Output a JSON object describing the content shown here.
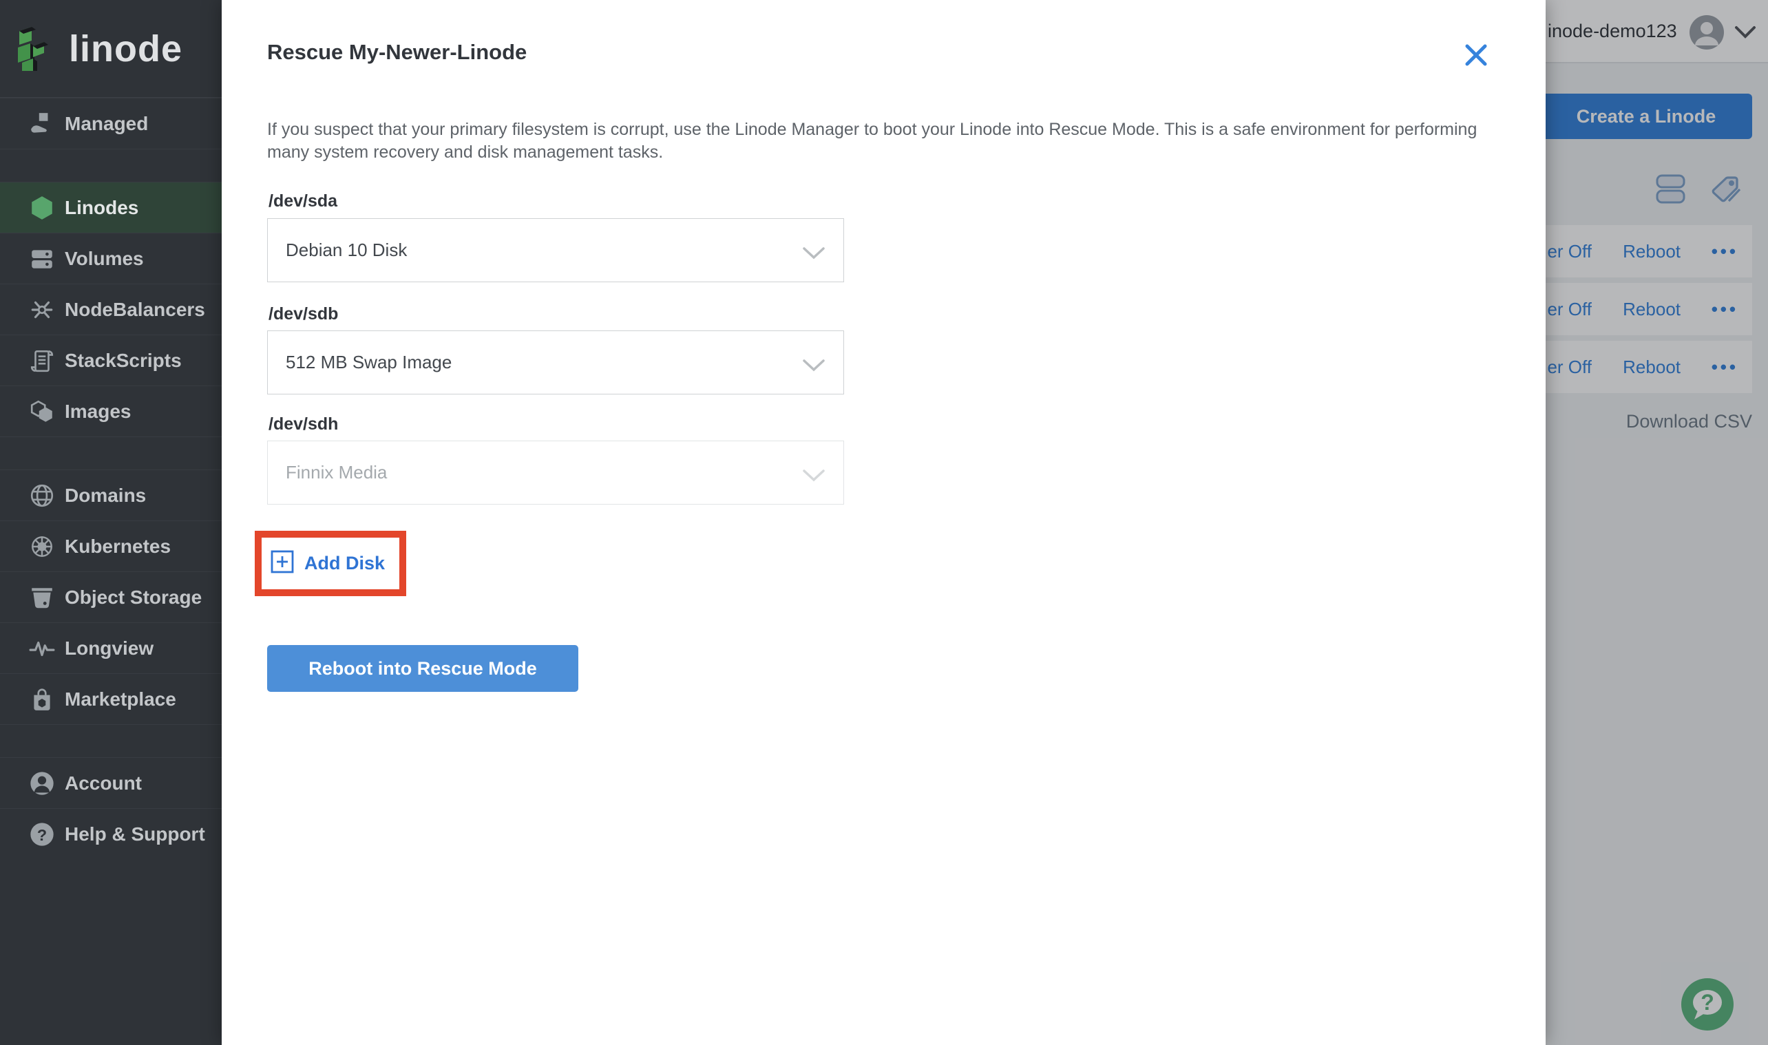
{
  "colors": {
    "accent_blue": "#3683dc",
    "link_blue": "#3683dc",
    "add_disk_blue": "#2f74d4",
    "highlight_red": "#e3462b",
    "sidebar_bg": "#2f3338",
    "sidebar_active_bg": "#2f4438",
    "active_green": "#58a56c",
    "help_green": "#5cb57e",
    "reboot_button_blue": "#4d8fd8"
  },
  "sidebar": {
    "logo_text": "linode",
    "groups": [
      {
        "items": [
          {
            "label": "Managed",
            "icon": "managed-icon"
          }
        ]
      },
      {
        "items": [
          {
            "label": "Linodes",
            "icon": "linodes-icon",
            "active": true
          },
          {
            "label": "Volumes",
            "icon": "volumes-icon"
          },
          {
            "label": "NodeBalancers",
            "icon": "nodebalancers-icon"
          },
          {
            "label": "StackScripts",
            "icon": "stackscripts-icon"
          },
          {
            "label": "Images",
            "icon": "images-icon"
          }
        ]
      },
      {
        "items": [
          {
            "label": "Domains",
            "icon": "domains-icon"
          },
          {
            "label": "Kubernetes",
            "icon": "kubernetes-icon"
          },
          {
            "label": "Object Storage",
            "icon": "object-storage-icon"
          },
          {
            "label": "Longview",
            "icon": "longview-icon"
          },
          {
            "label": "Marketplace",
            "icon": "marketplace-icon"
          }
        ]
      },
      {
        "items": [
          {
            "label": "Account",
            "icon": "account-icon"
          },
          {
            "label": "Help & Support",
            "icon": "help-icon"
          }
        ]
      }
    ]
  },
  "header": {
    "username": "inode-demo123",
    "create_button": "Create a Linode"
  },
  "listing": {
    "view_icons": [
      "summary-view-icon",
      "group-by-tag-icon"
    ],
    "rows": [
      {
        "power": "er Off",
        "reboot": "Reboot",
        "more": "•••"
      },
      {
        "power": "er Off",
        "reboot": "Reboot",
        "more": "•••"
      },
      {
        "power": "er Off",
        "reboot": "Reboot",
        "more": "•••"
      }
    ],
    "download_csv": "Download CSV"
  },
  "modal": {
    "title": "Rescue My-Newer-Linode",
    "close_icon": "x",
    "description": "If you suspect that your primary filesystem is corrupt, use the Linode Manager to boot your Linode into Rescue Mode. This is a safe environment for performing many system recovery and disk management tasks.",
    "fields": [
      {
        "label": "/dev/sda",
        "value": "Debian 10 Disk",
        "disabled": false
      },
      {
        "label": "/dev/sdb",
        "value": "512 MB Swap Image",
        "disabled": false
      },
      {
        "label": "/dev/sdh",
        "value": "Finnix Media",
        "disabled": true
      }
    ],
    "add_disk_label": "Add Disk",
    "reboot_button": "Reboot into Rescue Mode"
  },
  "glyphs": {
    "question": "?"
  }
}
